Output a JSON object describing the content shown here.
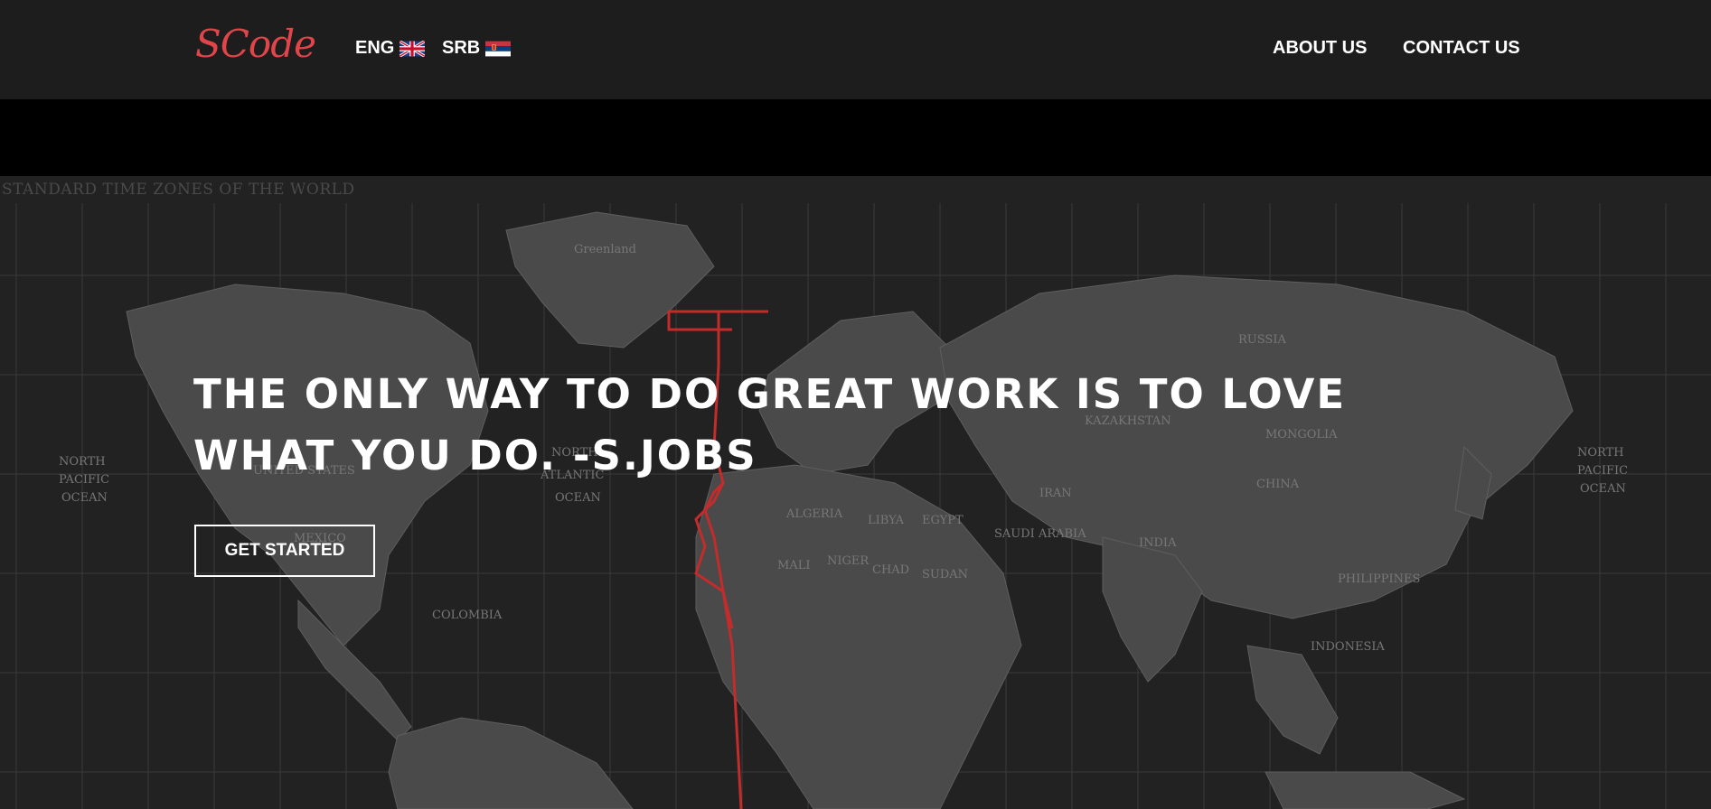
{
  "logo": {
    "text": "SCode"
  },
  "languages": [
    {
      "label": "ENG",
      "flag": "uk-flag-icon"
    },
    {
      "label": "SRB",
      "flag": "serbia-flag-icon"
    }
  ],
  "nav": {
    "about": "ABOUT US",
    "contact": "CONTACT US"
  },
  "hero": {
    "map_title": "STANDARD TIME ZONES OF THE WORLD",
    "quote": "THE ONLY WAY TO DO GREAT WORK IS TO LOVE WHAT YOU DO. -S.JOBS",
    "cta": "GET STARTED"
  },
  "map_labels": [
    "Greenland",
    "U.S.",
    "UNITED STATES",
    "MEXICO",
    "NORTH ATLANTIC OCEAN",
    "NORTH PACIFIC OCEAN",
    "ALGERIA",
    "LIBYA",
    "EGYPT",
    "SAUDI ARABIA",
    "IRAN",
    "KAZAKHSTAN",
    "MONGOLIA",
    "CHINA",
    "RUSSIA",
    "INDIA",
    "SUDAN",
    "NIGER",
    "CHAD",
    "MALI",
    "INDONESIA",
    "PHILIPPINES",
    "COLOMBIA"
  ],
  "colors": {
    "navbar": "#1d1d1d",
    "accent": "#e1454a",
    "hero_bg": "#222222",
    "land": "#4a4a4a"
  }
}
